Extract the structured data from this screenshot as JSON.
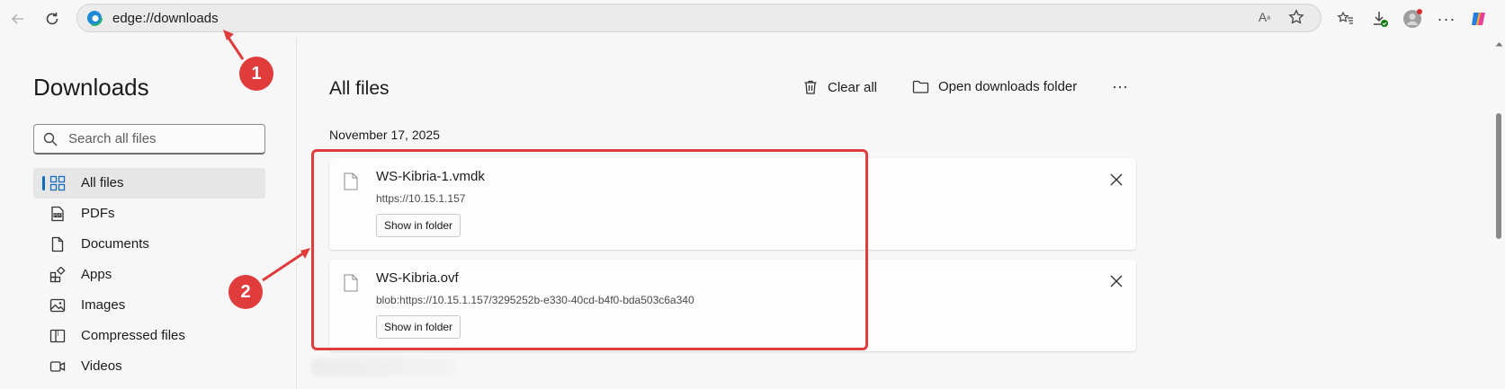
{
  "browser": {
    "address": "edge://downloads"
  },
  "sidebar": {
    "title": "Downloads",
    "search_placeholder": "Search all files",
    "items": [
      {
        "label": "All files",
        "icon": "grid-icon",
        "active": true
      },
      {
        "label": "PDFs",
        "icon": "pdf-icon"
      },
      {
        "label": "Documents",
        "icon": "document-icon"
      },
      {
        "label": "Apps",
        "icon": "apps-icon"
      },
      {
        "label": "Images",
        "icon": "image-icon"
      },
      {
        "label": "Compressed files",
        "icon": "archive-icon"
      },
      {
        "label": "Videos",
        "icon": "video-icon"
      }
    ]
  },
  "main": {
    "title": "All files",
    "clear_all": "Clear all",
    "open_folder": "Open downloads folder",
    "date": "November 17, 2025",
    "files": [
      {
        "name": "WS-Kibria-1.vmdk",
        "url": "https://10.15.1.157",
        "button": "Show in folder"
      },
      {
        "name": "WS-Kibria.ovf",
        "url": "blob:https://10.15.1.157/3295252b-e330-40cd-b4f0-bda503c6a340",
        "button": "Show in folder"
      }
    ]
  },
  "annotations": {
    "marker_1": "1",
    "marker_2": "2",
    "color": "#e03c3c"
  },
  "colors": {
    "accent": "#0f6cbd",
    "background": "#f7f7f7"
  }
}
